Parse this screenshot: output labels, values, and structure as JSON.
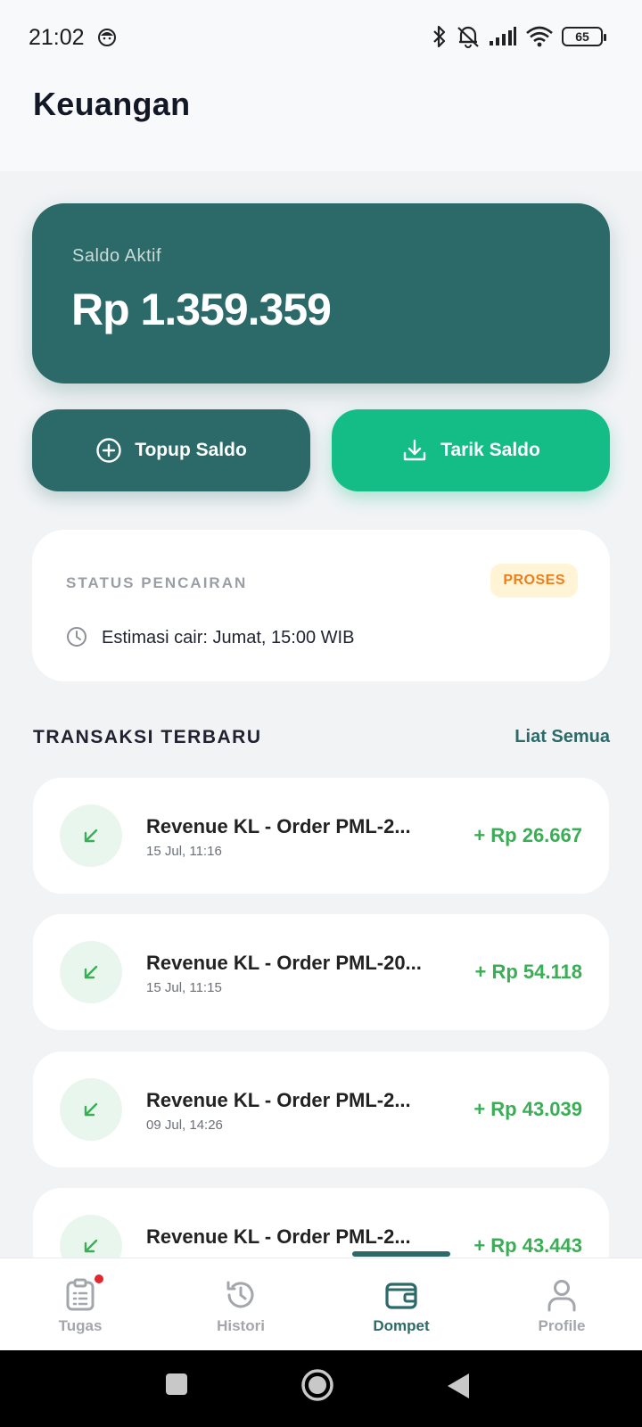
{
  "status_bar": {
    "time": "21:02",
    "battery": "65",
    "icons": [
      "face-icon",
      "bluetooth-icon",
      "mute-icon",
      "signal-icon",
      "wifi-icon",
      "battery-icon"
    ]
  },
  "header": {
    "title": "Keuangan"
  },
  "balance": {
    "label": "Saldo Aktif",
    "value": "Rp 1.359.359"
  },
  "actions": {
    "topup_label": "Topup Saldo",
    "tarik_label": "Tarik Saldo"
  },
  "withdrawal_status": {
    "heading": "STATUS PENCAIRAN",
    "badge": "PROSES",
    "estimate": "Estimasi cair: Jumat, 15:00 WIB"
  },
  "transactions": {
    "title": "TRANSAKSI TERBARU",
    "see_all": "Liat Semua",
    "items": [
      {
        "title": "Revenue KL - Order PML-2...",
        "date": "15 Jul, 11:16",
        "amount": "+ Rp 26.667"
      },
      {
        "title": "Revenue KL - Order PML-20...",
        "date": "15 Jul, 11:15",
        "amount": "+ Rp 54.118"
      },
      {
        "title": "Revenue KL - Order PML-2...",
        "date": "09 Jul, 14:26",
        "amount": "+ Rp 43.039"
      },
      {
        "title": "Revenue KL - Order PML-2...",
        "date": "",
        "amount": "+ Rp 43.443"
      }
    ]
  },
  "bottom_nav": {
    "items": [
      {
        "label": "Tugas"
      },
      {
        "label": "Histori"
      },
      {
        "label": "Dompet"
      },
      {
        "label": "Profile"
      }
    ],
    "active": "Dompet"
  },
  "colors": {
    "primary": "#2b6a68",
    "accent": "#14bd85",
    "positive": "#3aae55",
    "badge_text": "#f07d1a",
    "badge_bg": "#fff5d6"
  }
}
